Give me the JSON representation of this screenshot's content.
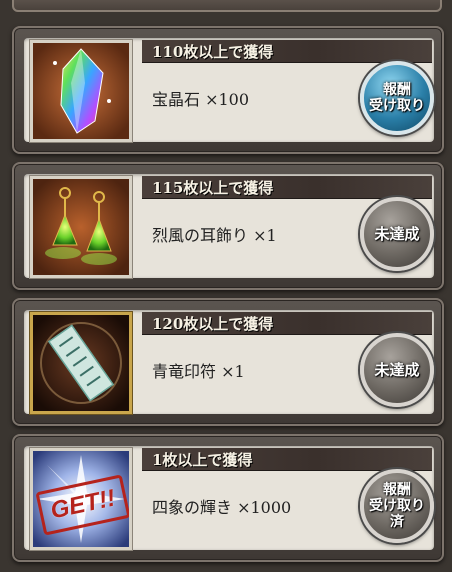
{
  "rewards": [
    {
      "threshold_text": "110枚以上で獲得",
      "item_text": "宝晶石 ×100",
      "icon": "rainbow-crystal-icon",
      "button": {
        "type": "claim",
        "line1": "報酬",
        "line2": "受け取り"
      }
    },
    {
      "threshold_text": "115枚以上で獲得",
      "item_text": "烈風の耳飾り ×1",
      "icon": "green-earrings-icon",
      "button": {
        "type": "unachieved",
        "line1": "未達成",
        "line2": ""
      }
    },
    {
      "threshold_text": "120枚以上で獲得",
      "item_text": "青竜印符 ×1",
      "icon": "blue-dragon-talisman-icon",
      "button": {
        "type": "unachieved",
        "line1": "未達成",
        "line2": ""
      }
    },
    {
      "threshold_text": "1枚以上で獲得",
      "item_text": "四象の輝き ×1000",
      "icon": "four-symbols-radiance-icon",
      "stamp": "GET!!",
      "button": {
        "type": "claimed",
        "line1": "報酬",
        "line2": "受け取り済"
      }
    }
  ],
  "colors": {
    "claim_button": "#2a7fa8",
    "disabled_button": "#6d6862",
    "header_bar": "#3a302c",
    "card_body": "#e7e3da",
    "stamp_red": "#b5231c"
  }
}
